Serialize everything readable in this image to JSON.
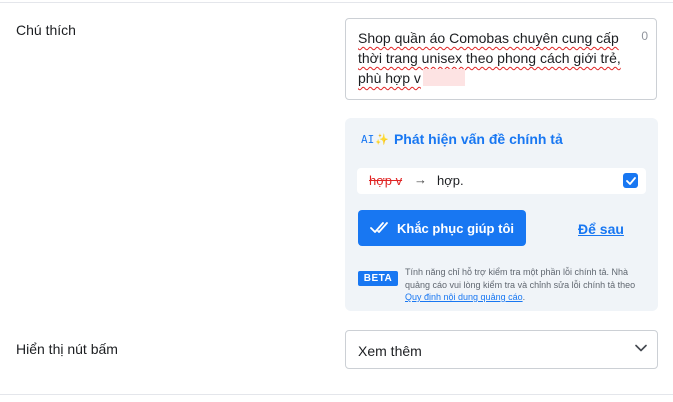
{
  "caption": {
    "label": "Chú thích",
    "text_line1": "Shop quần áo Comobas chuyên cung cấp",
    "text_line2": "thời trang unisex theo phong cách giới trẻ,",
    "text_line3": "phù hợp v",
    "char_count": "0"
  },
  "spellcheck": {
    "ai_badge": "AI",
    "title": "Phát hiện vấn đề chính tả",
    "wrong": "hợp v",
    "correction": "hợp.",
    "checked": true,
    "fix_button": "Khắc phục giúp tôi",
    "later_link": "Để sau",
    "beta_badge": "BETA",
    "note_text": "Tính năng chỉ hỗ trợ kiểm tra một phần lỗi chính tả. Nhà quảng cáo vui lòng kiểm tra và chỉnh sửa lỗi chính tả theo",
    "note_link": "Quy định nội dung quảng cáo",
    "note_end": "."
  },
  "cta": {
    "label": "Hiển thị nút bấm",
    "selected": "Xem thêm"
  },
  "colors": {
    "accent": "#1877f2",
    "error": "#e02424",
    "panel_bg": "#f0f4f8"
  }
}
